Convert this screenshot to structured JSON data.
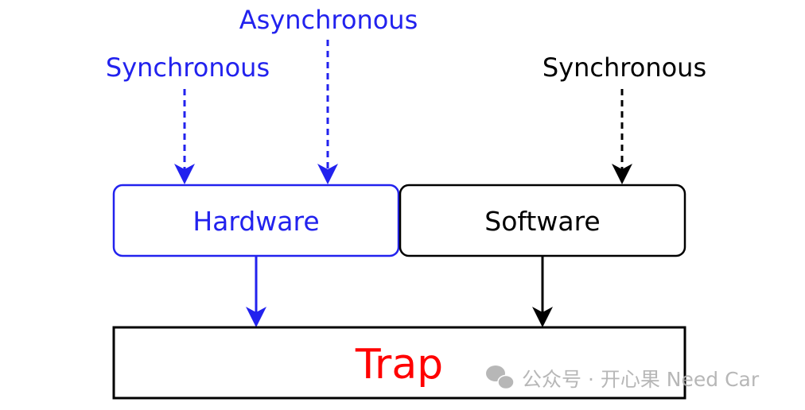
{
  "labels": {
    "async_hw": "Asynchronous",
    "sync_hw": "Synchronous",
    "sync_sw": "Synchronous"
  },
  "boxes": {
    "hardware": "Hardware",
    "software": "Software",
    "trap": "Trap"
  },
  "watermark": {
    "text": "公众号 · 开心果 Need Car",
    "icon": "wechat-icon"
  },
  "colors": {
    "hardware": "#2222ee",
    "software": "#000000",
    "trap": "#ff0000",
    "watermark": "#b0b0b0"
  }
}
